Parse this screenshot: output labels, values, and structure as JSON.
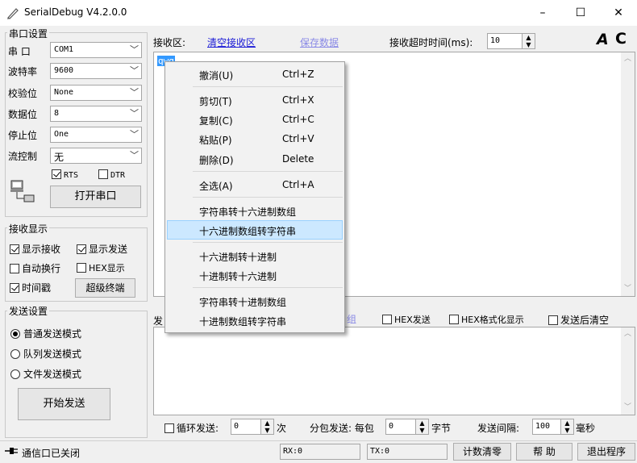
{
  "window": {
    "title": "SerialDebug V4.2.0.0",
    "minimize": "–",
    "maximize": "☐",
    "close": "✕"
  },
  "serial_settings": {
    "group_title": "串口设置",
    "port": {
      "label": "串 口",
      "value": "COM1"
    },
    "baud": {
      "label": "波特率",
      "value": "9600"
    },
    "parity": {
      "label": "校验位",
      "value": "None"
    },
    "databits": {
      "label": "数据位",
      "value": "8"
    },
    "stopbits": {
      "label": "停止位",
      "value": "One"
    },
    "flow": {
      "label": "流控制",
      "value": "无"
    },
    "rts": {
      "label": "RTS",
      "checked": true
    },
    "dtr": {
      "label": "DTR",
      "checked": false
    },
    "open_button": "打开串口"
  },
  "recv_display": {
    "group_title": "接收显示",
    "show_recv": {
      "label": "显示接收",
      "checked": true
    },
    "show_send": {
      "label": "显示发送",
      "checked": true
    },
    "auto_wrap": {
      "label": "自动换行",
      "checked": false
    },
    "hex_display": {
      "label": "HEX显示",
      "checked": false
    },
    "timestamp": {
      "label": "时间戳",
      "checked": true
    },
    "super_terminal": "超级终端"
  },
  "send_settings": {
    "group_title": "发送设置",
    "modes": [
      {
        "label": "普通发送模式",
        "selected": true
      },
      {
        "label": "队列发送模式",
        "selected": false
      },
      {
        "label": "文件发送模式",
        "selected": false
      }
    ],
    "start_button": "开始发送"
  },
  "recv_area": {
    "label": "接收区:",
    "clear_link": "清空接收区",
    "save_link": "保存数据",
    "timeout_label": "接收超时时间(ms):",
    "timeout_value": "10",
    "font_icon": "A",
    "refresh_icon": "C",
    "content": "qwq"
  },
  "send_area": {
    "label": "发",
    "hidden_link_tail": "组",
    "hex_send": {
      "label": "HEX发送",
      "checked": false
    },
    "hex_format": {
      "label": "HEX格式化显示",
      "checked": false
    },
    "clear_after": {
      "label": "发送后清空",
      "checked": false
    },
    "loop_send": {
      "label": "循环发送:",
      "checked": false
    },
    "loop_value": "0",
    "loop_unit": "次",
    "split_label": "分包发送: 每包",
    "split_value": "0",
    "split_unit": "字节",
    "interval_label": "发送间隔:",
    "interval_value": "100",
    "interval_unit": "毫秒"
  },
  "context_menu": {
    "items": [
      {
        "label": "撤消(U)",
        "shortcut": "Ctrl+Z"
      },
      {
        "label": "剪切(T)",
        "shortcut": "Ctrl+X"
      },
      {
        "label": "复制(C)",
        "shortcut": "Ctrl+C"
      },
      {
        "label": "粘贴(P)",
        "shortcut": "Ctrl+V"
      },
      {
        "label": "删除(D)",
        "shortcut": "Delete"
      },
      {
        "label": "全选(A)",
        "shortcut": "Ctrl+A"
      },
      {
        "label": "字符串转十六进制数组",
        "shortcut": ""
      },
      {
        "label": "十六进制数组转字符串",
        "shortcut": "",
        "highlighted": true
      },
      {
        "label": "十六进制转十进制",
        "shortcut": ""
      },
      {
        "label": "十进制转十六进制",
        "shortcut": ""
      },
      {
        "label": "字符串转十进制数组",
        "shortcut": ""
      },
      {
        "label": "十进制数组转字符串",
        "shortcut": ""
      }
    ]
  },
  "status_bar": {
    "port_status": "通信口已关闭",
    "rx": "RX:0",
    "tx": "TX:0",
    "reset_count": "计数清零",
    "help": "帮 助",
    "exit": "退出程序"
  },
  "icons": [
    "app-pen-icon",
    "plug-icon",
    "computer-icon",
    "font-icon",
    "refresh-icon"
  ]
}
